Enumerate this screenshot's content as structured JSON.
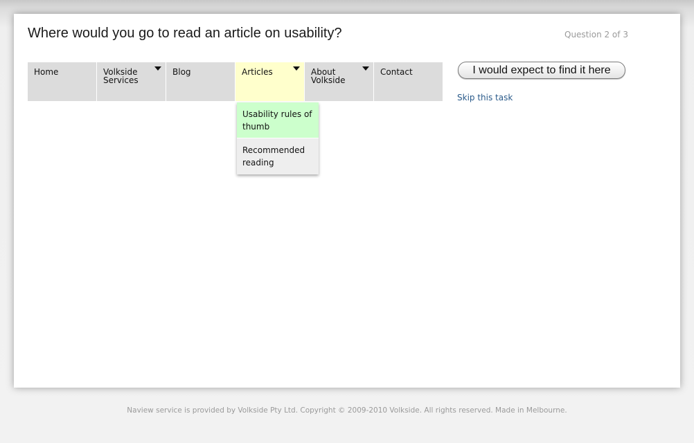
{
  "task": {
    "question": "Where would you go to read an article on usability?",
    "progress": "Question 2 of 3"
  },
  "nav": {
    "items": [
      {
        "label": "Home",
        "has_submenu": false,
        "active": false
      },
      {
        "label": "Volkside Services",
        "has_submenu": true,
        "active": false
      },
      {
        "label": "Blog",
        "has_submenu": false,
        "active": false
      },
      {
        "label": "Articles",
        "has_submenu": true,
        "active": true
      },
      {
        "label": "About Volkside",
        "has_submenu": true,
        "active": false
      },
      {
        "label": "Contact",
        "has_submenu": false,
        "active": false
      }
    ]
  },
  "dropdown": {
    "items": [
      {
        "label": "Usability rules of thumb",
        "highlighted": true
      },
      {
        "label": "Recommended reading",
        "highlighted": false
      }
    ]
  },
  "actions": {
    "answer_label": "I would expect to find it here",
    "skip_label": "Skip this task"
  },
  "footer": {
    "text": "Naview service is provided by Volkside Pty Ltd. Copyright © 2009-2010 Volkside. All rights reserved. Made in Melbourne."
  },
  "colors": {
    "nav_background": "#dcdcdc",
    "nav_active": "#ffffcc",
    "dropdown_highlight": "#ccffcc",
    "dropdown_background": "#eeeeee",
    "link": "#2a5a8a"
  }
}
